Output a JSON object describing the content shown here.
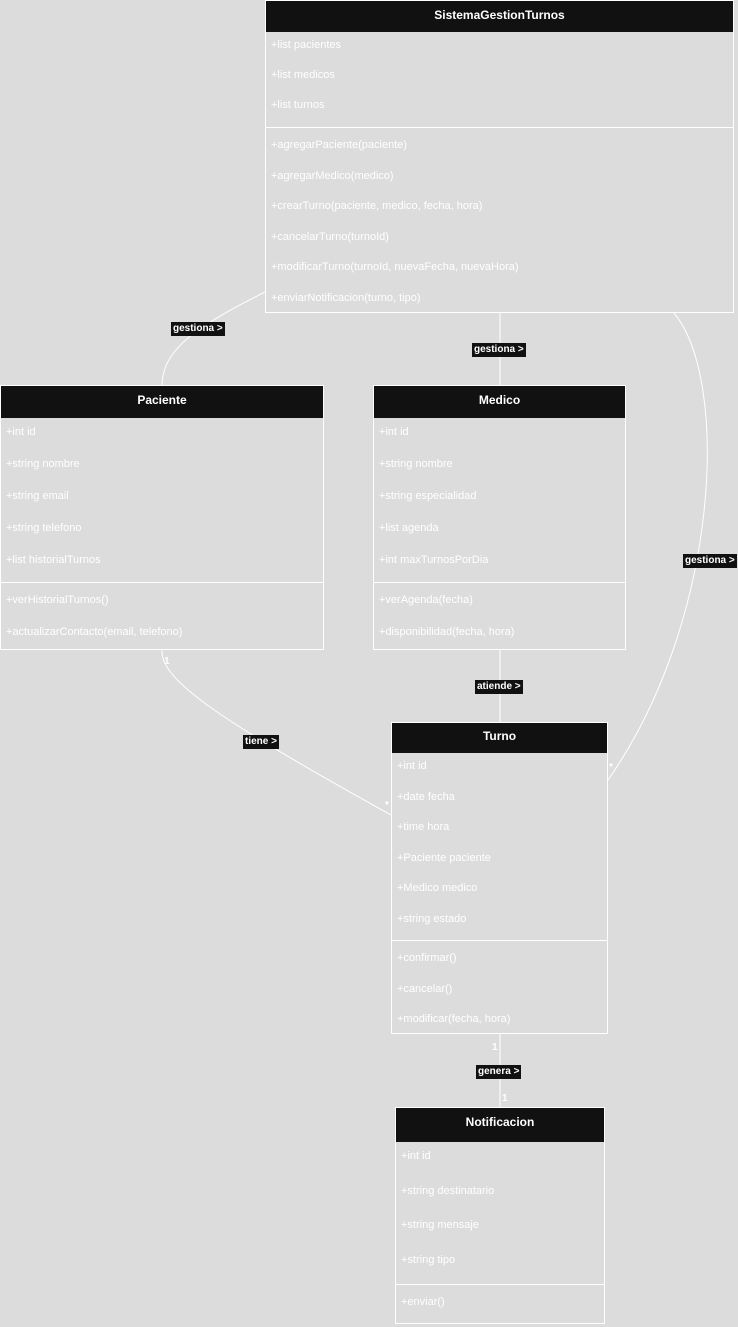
{
  "classes": {
    "sistema": {
      "name": "SistemaGestionTurnos",
      "attributes": [
        "+list pacientes",
        "+list medicos",
        "+list turnos"
      ],
      "methods": [
        "+agregarPaciente(paciente)",
        "+agregarMedico(medico)",
        "+crearTurno(paciente, medico, fecha, hora)",
        "+cancelarTurno(turnoId)",
        "+modificarTurno(turnoId, nuevaFecha, nuevaHora)",
        "+enviarNotificacion(turno, tipo)"
      ]
    },
    "paciente": {
      "name": "Paciente",
      "attributes": [
        "+int id",
        "+string nombre",
        "+string email",
        "+string telefono",
        "+list historialTurnos"
      ],
      "methods": [
        "+verHistorialTurnos()",
        "+actualizarContacto(email, telefono)"
      ]
    },
    "medico": {
      "name": "Medico",
      "attributes": [
        "+int id",
        "+string nombre",
        "+string especialidad",
        "+list agenda",
        "+int maxTurnosPorDia"
      ],
      "methods": [
        "+verAgenda(fecha)",
        "+disponibilidad(fecha, hora)"
      ]
    },
    "turno": {
      "name": "Turno",
      "attributes": [
        "+int id",
        "+date fecha",
        "+time hora",
        "+Paciente paciente",
        "+Medico medico",
        "+string estado"
      ],
      "methods": [
        "+confirmar()",
        "+cancelar()",
        "+modificar(fecha, hora)"
      ]
    },
    "notificacion": {
      "name": "Notificacion",
      "attributes": [
        "+int id",
        "+string destinatario",
        "+string mensaje",
        "+string tipo"
      ],
      "methods": [
        "+enviar()"
      ]
    }
  },
  "relations": {
    "sistema_paciente": "gestiona >",
    "sistema_medico": "gestiona >",
    "sistema_turno": "gestiona >",
    "medico_turno": "atiende >",
    "paciente_turno": "tiene >",
    "turno_notificacion": "genera >"
  },
  "multiplicities": {
    "paciente_turno_src": "1",
    "paciente_turno_dst": "*",
    "sistema_turno_dst": "*",
    "turno_notificacion_src": "1",
    "turno_notificacion_dst": "1"
  },
  "colors": {
    "background": "#dcdcdc",
    "header": "#111111",
    "line": "#ffffff",
    "text": "#ffffff"
  }
}
